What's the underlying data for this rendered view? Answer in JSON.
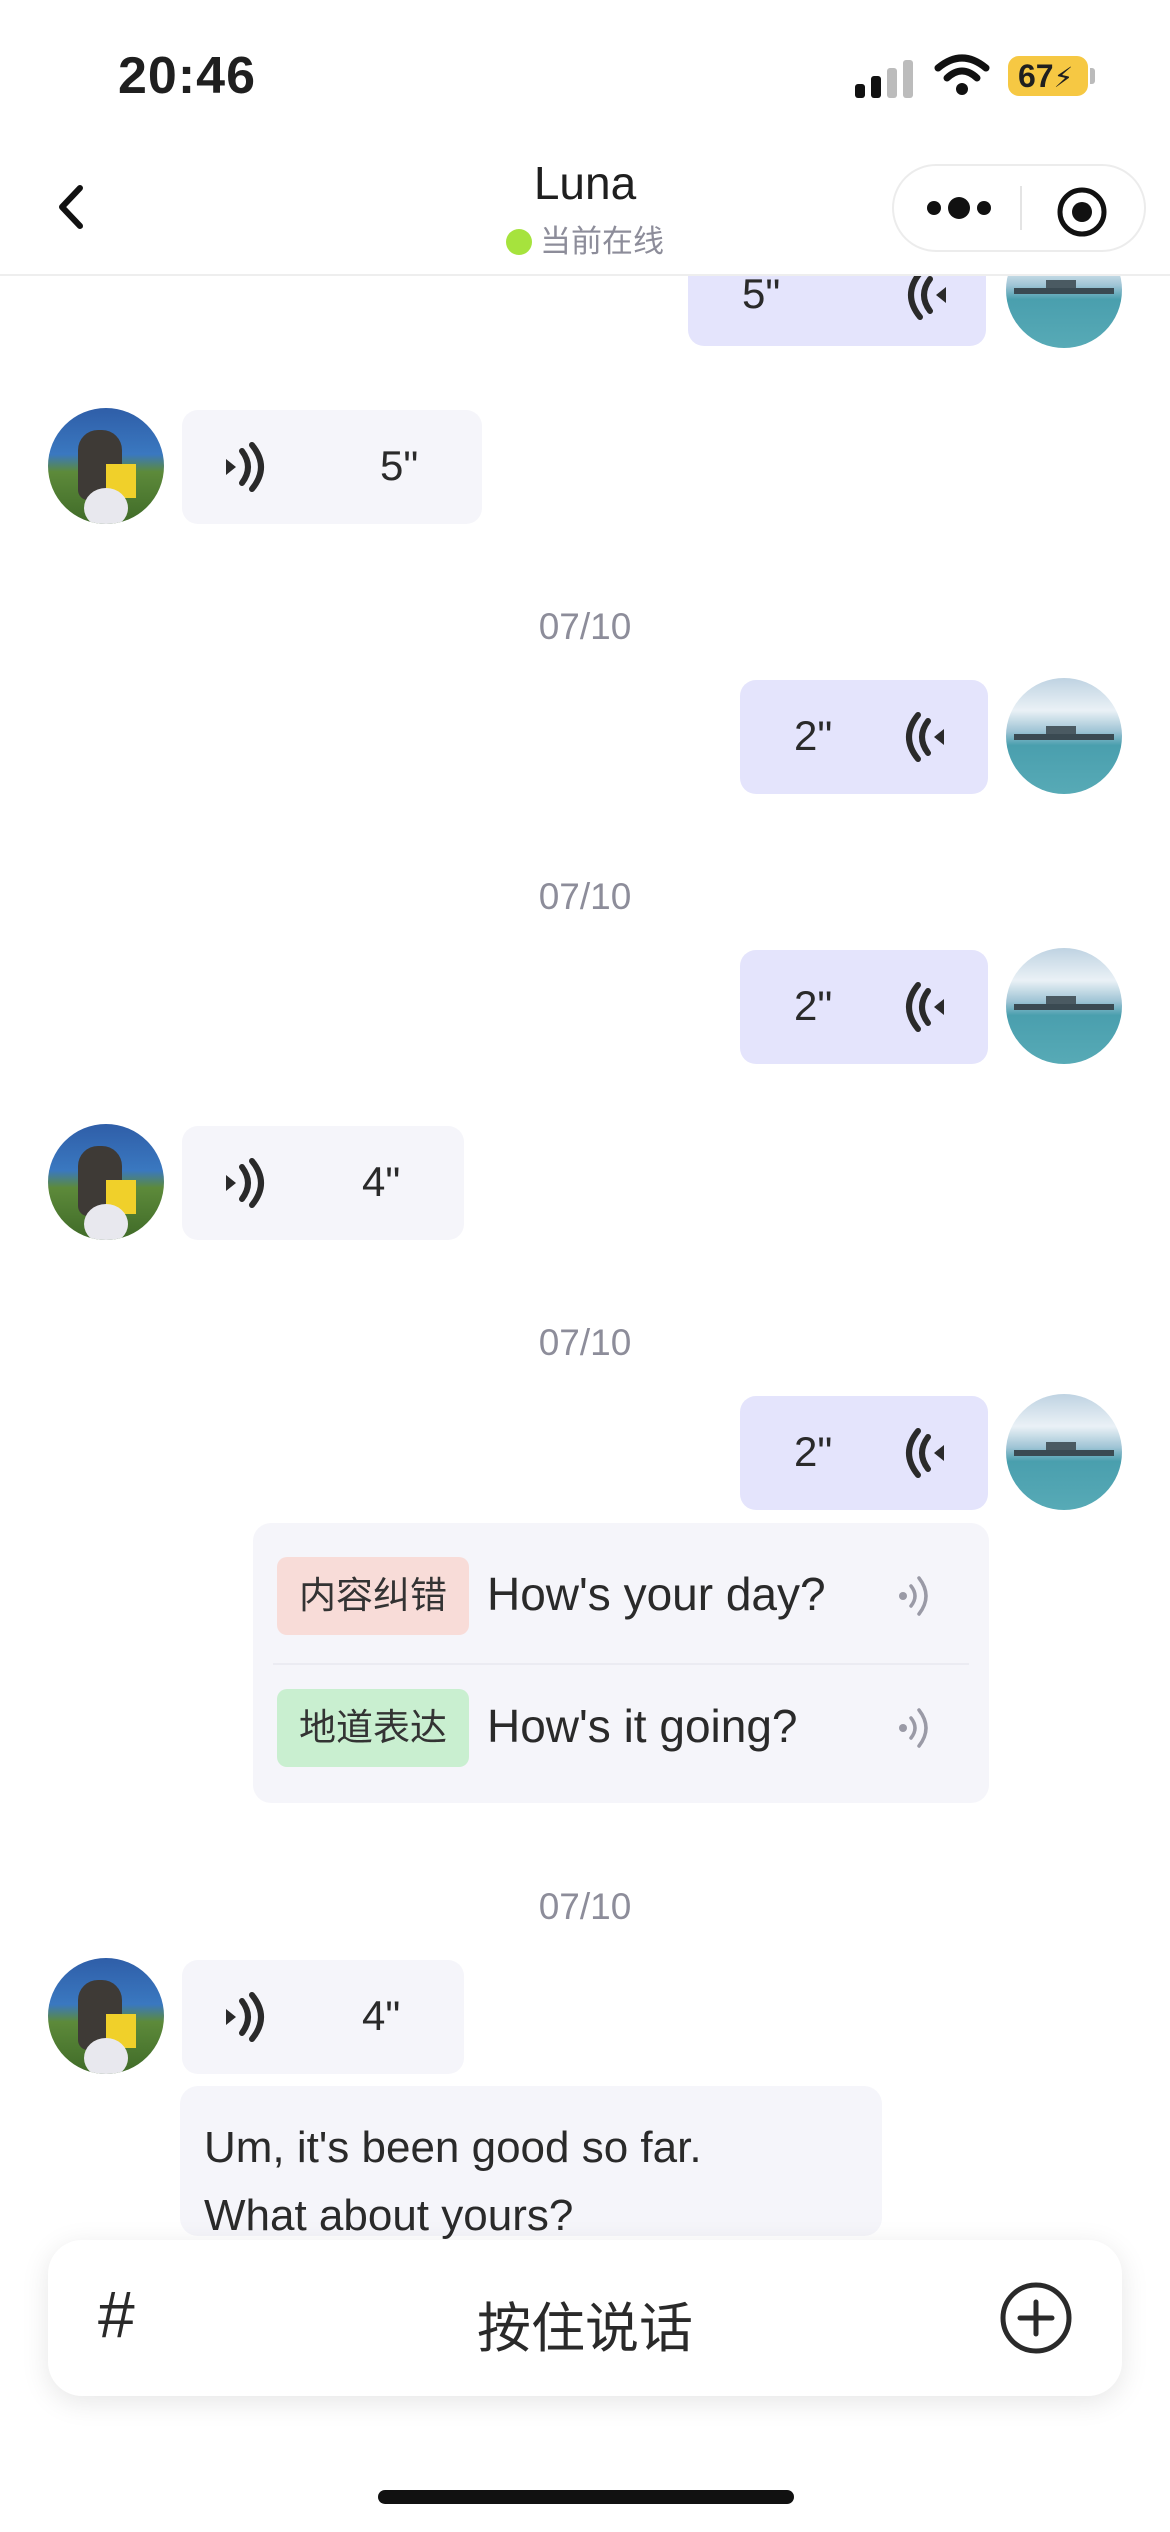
{
  "status_bar": {
    "time": "20:46",
    "battery": "67"
  },
  "header": {
    "title": "Luna",
    "status": "当前在线"
  },
  "messages": {
    "m0": {
      "duration": "5\""
    },
    "m1": {
      "duration": "5\""
    },
    "d1": "07/10",
    "m2": {
      "duration": "2\""
    },
    "d2": "07/10",
    "m3": {
      "duration": "2\""
    },
    "m4": {
      "duration": "4\""
    },
    "d3": "07/10",
    "m5": {
      "duration": "2\""
    },
    "d4": "07/10",
    "m6": {
      "duration": "4\""
    }
  },
  "correction": {
    "tag1": "内容纠错",
    "text1": "How's your day?",
    "tag2": "地道表达",
    "text2": "How's it going?"
  },
  "reply": {
    "line1": "Um, it's been good so far.",
    "line2": "What about yours?"
  },
  "input_bar": {
    "hash": "#",
    "hold_to_talk": "按住说话"
  },
  "colors": {
    "outgoing_bubble": "#e4e4fc",
    "incoming_bubble": "#f5f5fa",
    "online": "#a6e33d",
    "battery": "#f6c843"
  }
}
